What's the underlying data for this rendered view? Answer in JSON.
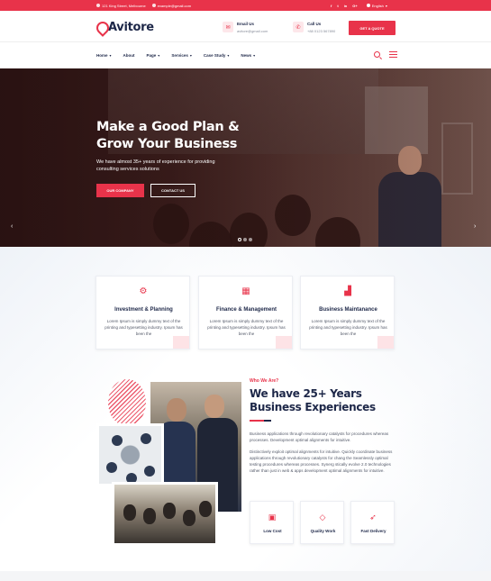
{
  "topbar": {
    "address": "121 King Street, Melbourne",
    "email": "example@gmail.com",
    "social": [
      "f",
      "t",
      "in",
      "G+"
    ],
    "language": "English"
  },
  "header": {
    "logo": "Avitore",
    "email_title": "Email Us",
    "email_value": "avitore@gmail.com",
    "call_title": "Call Us",
    "call_value": "+88 0123 567890",
    "quote_button": "GET A QUOTE"
  },
  "nav": {
    "items": [
      {
        "label": "Home",
        "has_menu": true
      },
      {
        "label": "About",
        "has_menu": false
      },
      {
        "label": "Page",
        "has_menu": true
      },
      {
        "label": "Services",
        "has_menu": true
      },
      {
        "label": "Case Study",
        "has_menu": true
      },
      {
        "label": "News",
        "has_menu": true
      }
    ]
  },
  "hero": {
    "title": "Make a Good Plan & Grow Your Business",
    "subtitle": "We have almost 35+ years of experience for providing consulting services solutions",
    "primary_button": "OUR COMPANY",
    "secondary_button": "CONTACT US",
    "prev_arrow": "‹",
    "next_arrow": "›"
  },
  "features": [
    {
      "icon": "growth-chart-icon",
      "title": "Investment & Planning",
      "text": "Lorem Ipsum is simply dummy text of the printing and typesetting industry. Ipsum has been the"
    },
    {
      "icon": "finance-icon",
      "title": "Finance & Management",
      "text": "Lorem Ipsum is simply dummy text of the printing and typesetting industry. Ipsum has been the"
    },
    {
      "icon": "analytics-icon",
      "title": "Business Maintanance",
      "text": "Lorem Ipsum is simply dummy text of the printing and typesetting industry. Ipsum has been the"
    }
  ],
  "about": {
    "kicker": "Who We Are?",
    "title": "We have 25+ Years Business Experiences",
    "para1": "Business applications through revolutionary catalysts for procedures whereas processes. Development optimal alignments for intuitive.",
    "para2": "Distinctively exploit optimal alignments for intuitive. Quickly coordinate business applications through revolutionary catalysts for chang the Seamlessly optimal testing procedures whereas processes. Synerg stically evolve 2.0 technologies rather than just in web & apps development optimal alignments for intuitive."
  },
  "highlights": [
    {
      "icon": "wallet-icon",
      "label": "Low Cost"
    },
    {
      "icon": "diamond-icon",
      "label": "Quality Work"
    },
    {
      "icon": "rocket-icon",
      "label": "Fast Delivery"
    }
  ],
  "colors": {
    "accent": "#e8334a",
    "navy": "#1d2748"
  }
}
